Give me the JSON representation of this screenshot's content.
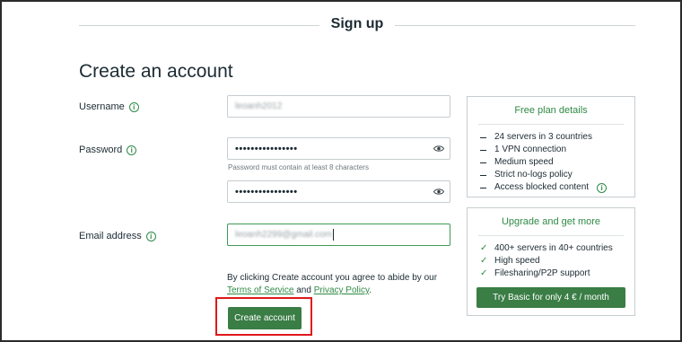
{
  "header": {
    "title": "Sign up"
  },
  "form": {
    "title": "Create an account",
    "username": {
      "label": "Username",
      "value": "leoanh2012"
    },
    "password": {
      "label": "Password",
      "value": "••••••••••••••••",
      "hint": "Password must contain at least 8 characters",
      "confirm_value": "••••••••••••••••"
    },
    "email": {
      "label": "Email address",
      "value": "leoanh2299@gmail.com"
    },
    "terms": {
      "prefix": "By clicking Create account you agree to abide by our ",
      "terms_link": "Terms of Service",
      "middle": " and ",
      "privacy_link": "Privacy Policy",
      "suffix": "."
    },
    "submit_label": "Create account"
  },
  "free_plan": {
    "title": "Free plan details",
    "items": [
      "24 servers in 3 countries",
      "1 VPN connection",
      "Medium speed",
      "Strict no-logs policy",
      "Access blocked content"
    ]
  },
  "upgrade": {
    "title": "Upgrade and get more",
    "items": [
      "400+ servers in 40+ countries",
      "High speed",
      "Filesharing/P2P support"
    ],
    "button_label": "Try Basic for only 4 € / month"
  },
  "colors": {
    "accent": "#2f8a45",
    "button": "#3a7d45",
    "highlight": "#e0181c"
  }
}
